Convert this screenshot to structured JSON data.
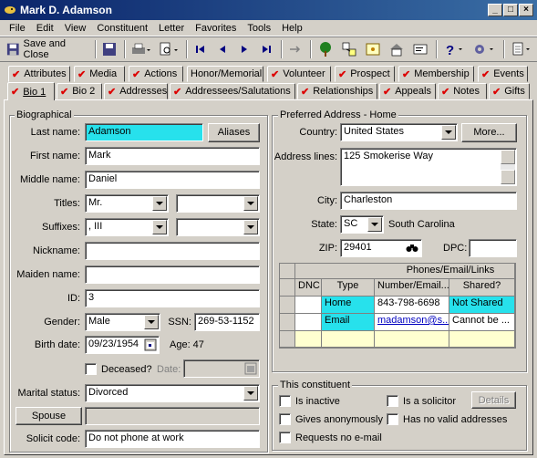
{
  "window": {
    "title": "Mark D. Adamson"
  },
  "menu": [
    "File",
    "Edit",
    "View",
    "Constituent",
    "Letter",
    "Favorites",
    "Tools",
    "Help"
  ],
  "toolbar": {
    "save_close": "Save and Close"
  },
  "tabs_row1": [
    "Attributes",
    "Media",
    "Actions",
    "Honor/Memorial",
    "Volunteer",
    "Prospect",
    "Membership",
    "Events"
  ],
  "tabs_row2": [
    "Bio 1",
    "Bio 2",
    "Addresses",
    "Addressees/Salutations",
    "Relationships",
    "Appeals",
    "Notes",
    "Gifts"
  ],
  "biographical": {
    "group_label": "Biographical",
    "last_name_label": "Last name:",
    "last_name": "Adamson",
    "aliases_button": "Aliases",
    "first_name_label": "First name:",
    "first_name": "Mark",
    "middle_name_label": "Middle name:",
    "middle_name": "Daniel",
    "titles_label": "Titles:",
    "title1": "Mr.",
    "title2": "",
    "suffixes_label": "Suffixes:",
    "suffix1": ", III",
    "suffix2": "",
    "nickname_label": "Nickname:",
    "nickname": "",
    "maiden_name_label": "Maiden name:",
    "maiden_name": "",
    "id_label": "ID:",
    "id": "3",
    "gender_label": "Gender:",
    "gender": "Male",
    "ssn_label": "SSN:",
    "ssn": "269-53-1152",
    "birth_date_label": "Birth date:",
    "birth_date": "09/23/1954",
    "age_label": "Age: 47",
    "deceased_label": "Deceased?",
    "date_label": "Date:",
    "marital_status_label": "Marital status:",
    "marital_status": "Divorced",
    "spouse_button": "Spouse",
    "spouse": "",
    "solicit_code_label": "Solicit code:",
    "solicit_code": "Do not phone at work"
  },
  "address": {
    "group_label": "Preferred Address - Home",
    "country_label": "Country:",
    "country": "United States",
    "more_button": "More...",
    "address_lines_label": "Address lines:",
    "address_lines": "125 Smokerise Way",
    "city_label": "City:",
    "city": "Charleston",
    "state_label": "State:",
    "state": "SC",
    "state_name": "South Carolina",
    "zip_label": "ZIP:",
    "zip": "29401",
    "dpc_label": "DPC:",
    "dpc": ""
  },
  "phones": {
    "title": "Phones/Email/Links",
    "headers": [
      "DNC",
      "Type",
      "Number/Email...",
      "Shared?"
    ],
    "rows": [
      {
        "dnc": "",
        "type": "Home",
        "number": "843-798-6698",
        "shared": "Not Shared"
      },
      {
        "dnc": "",
        "type": "Email",
        "number": "madamson@s...",
        "shared": "Cannot be ..."
      }
    ]
  },
  "constituent": {
    "group_label": "This constituent",
    "is_inactive": "Is inactive",
    "gives_anonymously": "Gives anonymously",
    "requests_no_email": "Requests no e-mail",
    "is_solicitor": "Is a solicitor",
    "details_button": "Details",
    "no_valid_addresses": "Has no valid addresses"
  },
  "colors": {
    "highlight": "#27e1ec",
    "title_start": "#0a246a",
    "check": "#dd0000"
  }
}
